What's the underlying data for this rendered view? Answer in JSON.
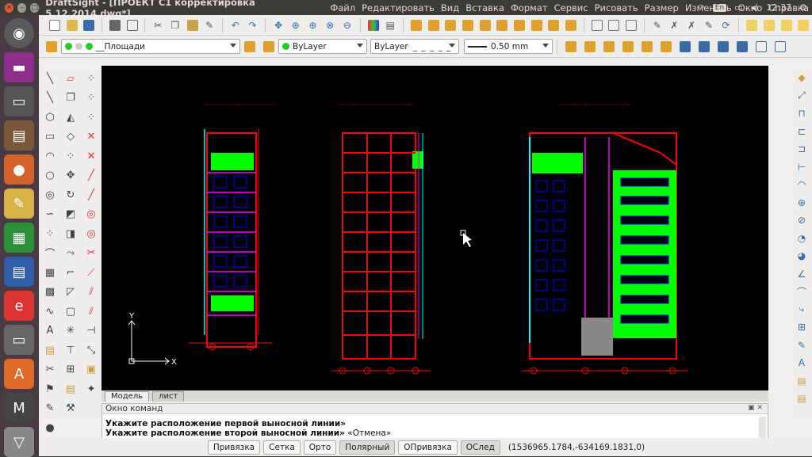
{
  "window": {
    "title": "DraftSight - [ПРОЕКТ С1 корректировка 5.12.2014.dwg*]"
  },
  "menu": [
    "Файл",
    "Редактировать",
    "Вид",
    "Вставка",
    "Формат",
    "Сервис",
    "Рисовать",
    "Размер",
    "Изменить",
    "Окно",
    "Справка"
  ],
  "tray": {
    "keyboard": "En",
    "time": "12:37"
  },
  "layer": {
    "name": "__Площади",
    "color": "ByLayer",
    "linestyle": "ByLayer",
    "lineweight": "0.50 mm"
  },
  "canvas": {
    "bg": "#000000",
    "axis_x": "X",
    "axis_y": "Y"
  },
  "tabs": [
    "Модель",
    "лист"
  ],
  "command": {
    "title": "Окно команд",
    "lines": [
      {
        "bold": "Укажите расположение первой выносной линии»",
        "rest": ""
      },
      {
        "bold": "Укажите расположение второй выносной линии»",
        "rest": " «Отмена»"
      }
    ],
    "prompt": ":"
  },
  "status": {
    "buttons": [
      "Привязка",
      "Сетка",
      "Орто",
      "Полярный",
      "ОПривязка",
      "ОСлед"
    ],
    "coords": "(1536965.1784,-634169.1831,0)"
  },
  "colors": {
    "accent_green": "#00ff00",
    "drawing_red": "#ff0000",
    "drawing_blue": "#0000ff",
    "drawing_magenta": "#ff00ff",
    "drawing_cyan": "#00ffff"
  }
}
